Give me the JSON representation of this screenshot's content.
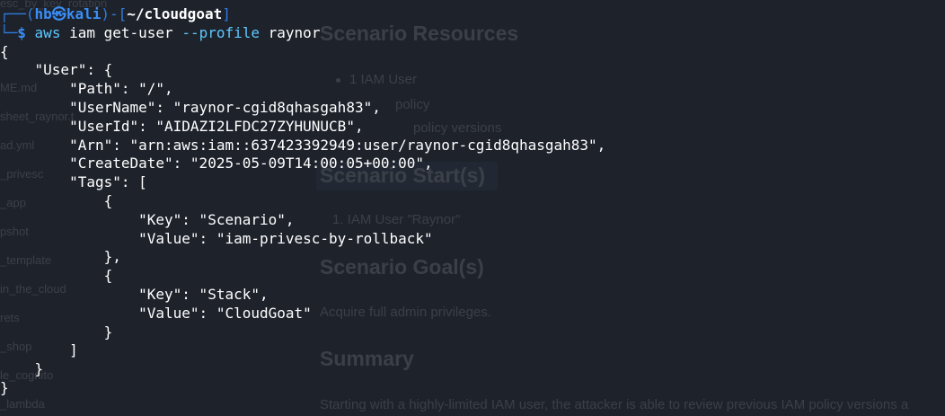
{
  "prompt": {
    "frame_open": "┌──(",
    "user": "hb",
    "at_symbol": "㉿",
    "host": "kali",
    "frame_mid": ")-[",
    "cwd": "~/cloudgoat",
    "frame_close": "]",
    "frame_bottom": "└─",
    "dollar": "$",
    "command": {
      "program": "aws",
      "args": " iam get-user ",
      "flag": "--profile",
      "value": " raynor"
    }
  },
  "output_lines": [
    "{",
    "    \"User\": {",
    "        \"Path\": \"/\",",
    "        \"UserName\": \"raynor-cgid8qhasgah83\",",
    "        \"UserId\": \"AIDAZI2LFDC27ZYHUNUCB\",",
    "        \"Arn\": \"arn:aws:iam::637423392949:user/raynor-cgid8qhasgah83\",",
    "        \"CreateDate\": \"2025-05-09T14:00:05+00:00\",",
    "        \"Tags\": [",
    "            {",
    "                \"Key\": \"Scenario\",",
    "                \"Value\": \"iam-privesc-by-rollback\"",
    "            },",
    "            {",
    "                \"Key\": \"Stack\",",
    "                \"Value\": \"CloudGoat\"",
    "            }",
    "        ]",
    "    }",
    "}"
  ],
  "background_window": {
    "sidebar_items": [
      "ME.md",
      "sheet_raynor.t",
      "ad.yml",
      "_privesc",
      "_app",
      "pshot",
      "_template",
      "in_the_cloud",
      "rets",
      "_shop",
      "le_cognito",
      "_lambda"
    ],
    "headings": [
      "Scenario Resources",
      "Scenario Start(s)",
      "Scenario Goal(s)",
      "Summary"
    ],
    "resources_items": [
      "1 IAM User",
      "policy",
      "policy versions"
    ],
    "start_items": [
      "1. IAM User \"Raynor\""
    ],
    "goal_text": "Acquire full admin privileges.",
    "summary_text": "Starting with a highly-limited IAM user, the attacker is able to review previous IAM policy versions a"
  },
  "colors": {
    "background": "#1d222b",
    "prompt_blue": "#3a8ef6",
    "command_cyan": "#5ec8ff",
    "text": "#ffffff"
  }
}
